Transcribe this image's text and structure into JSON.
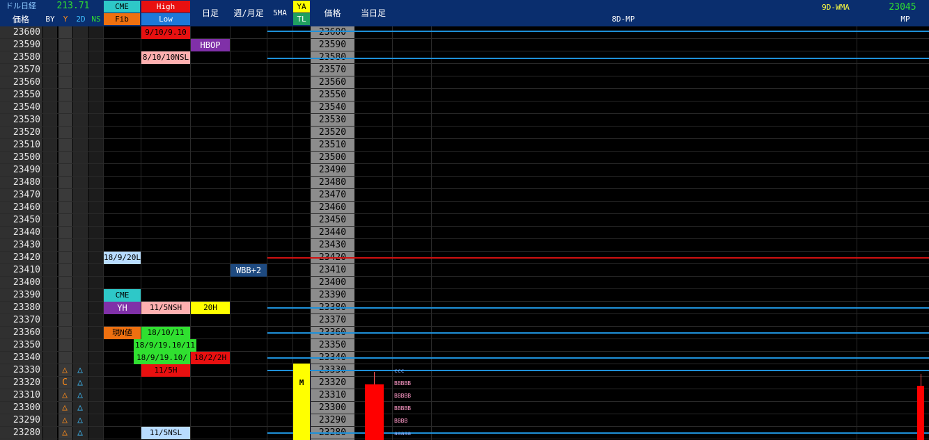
{
  "header": {
    "usdjpy_label": "ドル日経",
    "usdjpy_value": "213.71",
    "cme_label": "CME",
    "fib_label": "Fib",
    "high_label": "High",
    "low_label": "Low",
    "daily_label": "日足",
    "weekly_monthly_label": "週/月足",
    "ma5_label": "5MA",
    "ya_label": "YA",
    "tl_label": "TL",
    "price_label": "価格",
    "price2_label": "価格",
    "today_label": "当日足",
    "wma_label": "9D-WMA",
    "wma_value": "23045",
    "mp8_label": "8D-MP",
    "mp_label": "MP",
    "by_label": "BY",
    "y_label": "Y",
    "d2_label": "2D",
    "ns_label": "NS"
  },
  "prices": [
    "23600",
    "23590",
    "23580",
    "23570",
    "23560",
    "23550",
    "23540",
    "23530",
    "23520",
    "23510",
    "23500",
    "23490",
    "23480",
    "23470",
    "23460",
    "23450",
    "23440",
    "23430",
    "23420",
    "23410",
    "23400",
    "23390",
    "23380",
    "23370",
    "23360",
    "23350",
    "23340",
    "23330",
    "23320",
    "23310",
    "23300",
    "23290",
    "23280"
  ],
  "labels": {
    "cme_high": "9/10/9.10",
    "cme_low": "8/10/10NSL",
    "hbop": "HBOP",
    "fib_1": "18/9/20L",
    "wbb": "WBB+2",
    "cme2": "CME",
    "yh": "YH",
    "nsh": "11/5NSH",
    "h20": "20H",
    "gen_n": "現N値",
    "hl_1": "18/10/11",
    "hl_2": "18/9/19.10/11",
    "hl_3": "18/9/19.10/",
    "hl_4": "18/2/2H",
    "hl_5": "11/5H",
    "nsl": "11/5NSL",
    "m_mark": "M"
  },
  "markers": {
    "y_col": [
      "△",
      "C",
      "△",
      "△",
      "△",
      "△"
    ],
    "d2_col": [
      "△",
      "△",
      "△",
      "△",
      "△",
      "△"
    ]
  },
  "tpo": {
    "r1": "ccc",
    "r2": "BBBBB",
    "r3": "BBBBB",
    "r4": "BBBBB",
    "r5": "BBBB",
    "r6": "aaaaa"
  },
  "colors": {
    "header_bg": "#0a2e6e",
    "blue_line": "#1e90d8",
    "red_line": "#d01010",
    "bar_red": "#ff0000"
  }
}
